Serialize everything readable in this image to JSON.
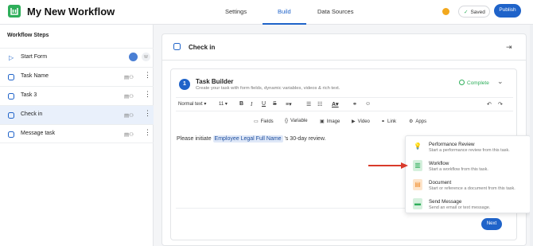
{
  "app": {
    "title": "My New Workflow"
  },
  "header": {
    "tabs": [
      {
        "label": "Settings"
      },
      {
        "label": "Build"
      },
      {
        "label": "Data Sources"
      }
    ],
    "saved_label": "Saved",
    "publish_label": "Publish"
  },
  "sidebar": {
    "title": "Workflow Steps",
    "items": [
      {
        "label": "Start Form",
        "badge": "W"
      },
      {
        "label": "Task Name"
      },
      {
        "label": "Task 3"
      },
      {
        "label": "Check in"
      },
      {
        "label": "Message task"
      }
    ]
  },
  "main": {
    "step_title": "Check in",
    "builder": {
      "number": "1",
      "title": "Task Builder",
      "subtitle": "Create your task with form fields, dynamic variables, videos & rich text.",
      "status": "Complete",
      "toolbar": {
        "text_style": "Normal text",
        "font_size": "11"
      },
      "insert": [
        {
          "label": "Fields",
          "icon": "fields-icon"
        },
        {
          "label": "Variable",
          "icon": "variable-icon"
        },
        {
          "label": "Image",
          "icon": "image-icon"
        },
        {
          "label": "Video",
          "icon": "video-icon"
        },
        {
          "label": "Link",
          "icon": "link-icon"
        },
        {
          "label": "Apps",
          "icon": "apps-icon"
        }
      ],
      "editor": {
        "before": "Please initiate ",
        "token": "Employee Legal Full Name",
        "after": " 's  30-day review."
      },
      "next_label": "Next"
    }
  },
  "apps_menu": {
    "items": [
      {
        "title": "Performance Review",
        "description": "Start a performance review from this task.",
        "icon": "lightbulb-icon",
        "color": "#f2a81d"
      },
      {
        "title": "Workflow",
        "description": "Start a workflow from this task.",
        "icon": "workflow-icon",
        "color": "#2eae5a"
      },
      {
        "title": "Document",
        "description": "Start or reference a document from this task.",
        "icon": "document-icon",
        "color": "#f08c2a"
      },
      {
        "title": "Send Message",
        "description": "Send an email or text message.",
        "icon": "message-icon",
        "color": "#2eae5a"
      }
    ]
  },
  "colors": {
    "accent": "#1f63c9",
    "success": "#2eae5a",
    "annotation_arrow": "#d93a2b"
  }
}
